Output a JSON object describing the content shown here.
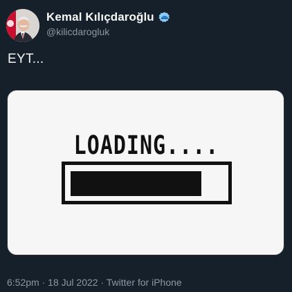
{
  "author": {
    "display_name": "Kemal Kılıçdaroğlu",
    "handle": "@kilicdarogluk",
    "verified_icon": "verified-badge-icon"
  },
  "tweet": {
    "text": "EYT..."
  },
  "media": {
    "loading_text": "LOADING....",
    "progress_fraction": 0.86
  },
  "meta": {
    "time": "6:52pm",
    "separator": "·",
    "date": "18 Jul 2022",
    "source": "Twitter for iPhone"
  },
  "colors": {
    "background": "#15202b",
    "verified_badge": "#8ecdf8",
    "secondary_text": "#8b98a5"
  }
}
